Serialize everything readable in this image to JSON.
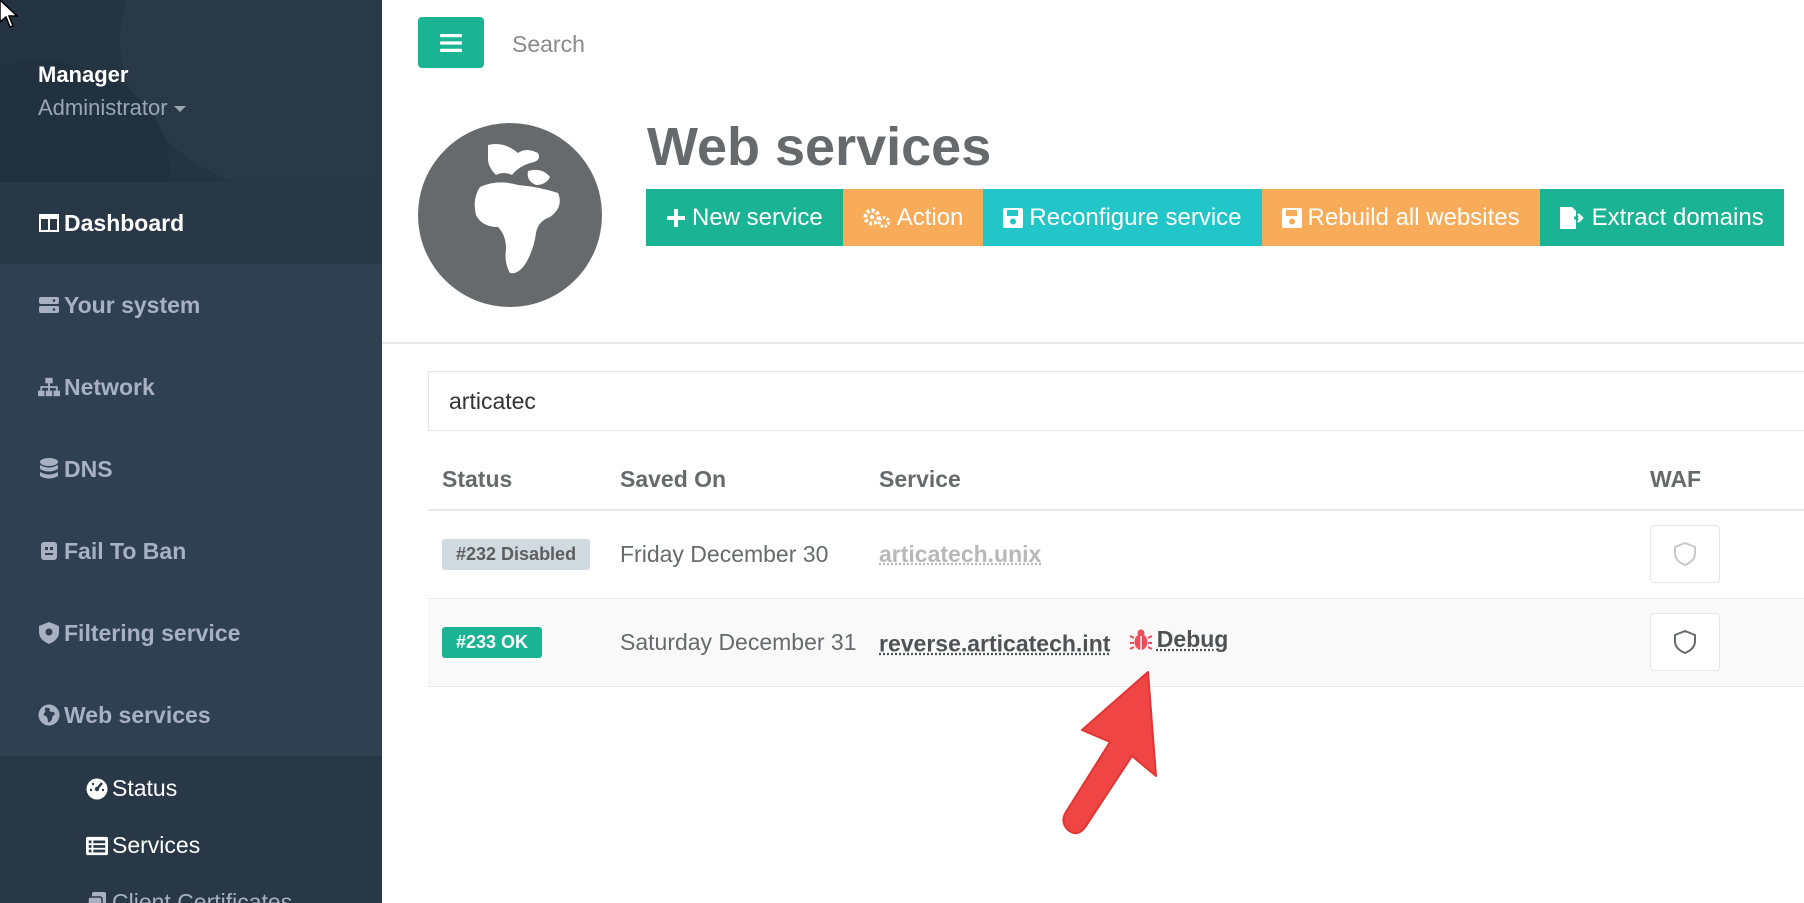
{
  "sidebar": {
    "profile": {
      "name": "Manager",
      "role": "Administrator"
    },
    "items": [
      {
        "label": "Dashboard",
        "icon": "columns-icon"
      },
      {
        "label": "Your system",
        "icon": "server-icon"
      },
      {
        "label": "Network",
        "icon": "sitemap-icon"
      },
      {
        "label": "DNS",
        "icon": "database-icon"
      },
      {
        "label": "Fail To Ban",
        "icon": "ban-icon"
      },
      {
        "label": "Filtering service",
        "icon": "shield-gear-icon"
      },
      {
        "label": "Web services",
        "icon": "globe-icon"
      }
    ],
    "sub_items": [
      {
        "label": "Status",
        "icon": "tachometer-icon"
      },
      {
        "label": "Services",
        "icon": "list-icon"
      },
      {
        "label": "Client Certificates",
        "icon": "files-icon"
      }
    ]
  },
  "topbar": {
    "search_placeholder": "Search"
  },
  "header": {
    "title": "Web services",
    "buttons": [
      {
        "label": "New service",
        "icon": "plus-icon"
      },
      {
        "label": "Action",
        "icon": "cogs-icon"
      },
      {
        "label": "Reconfigure service",
        "icon": "save-icon"
      },
      {
        "label": "Rebuild all websites",
        "icon": "save-icon"
      },
      {
        "label": "Extract domains",
        "icon": "file-export-icon"
      }
    ]
  },
  "filter": {
    "value": "articatec"
  },
  "table": {
    "columns": [
      "Status",
      "Saved On",
      "Service",
      "WAF"
    ],
    "rows": [
      {
        "status": "#232 Disabled",
        "saved_on": "Friday December 30",
        "service": "articatech.unix",
        "debug": ""
      },
      {
        "status": "#233 OK",
        "saved_on": "Saturday December 31",
        "service": "reverse.articatech.int",
        "debug": "Debug"
      }
    ]
  },
  "colors": {
    "sidebar_bg": "#2f4050",
    "primary": "#1ab394",
    "warning": "#f8ac59",
    "info": "#23c6c8",
    "annotation_arrow": "#f04545"
  }
}
